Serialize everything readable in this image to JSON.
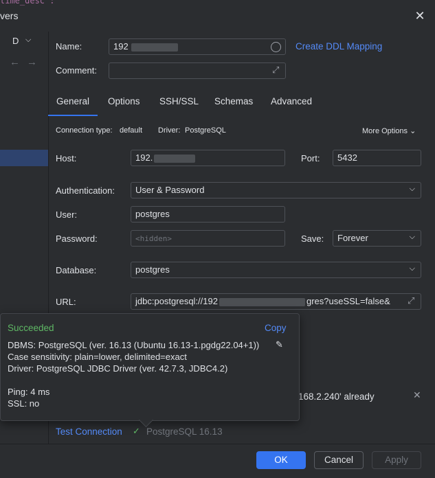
{
  "window": {
    "title": "vers",
    "bg_code": "time_desc :"
  },
  "left": {
    "dropdown_value": "D",
    "back_arrow": "←",
    "forward_arrow": "→"
  },
  "form": {
    "name_label": "Name:",
    "name_value": "192",
    "create_ddl_link": "Create DDL Mapping",
    "comment_label": "Comment:"
  },
  "tabs": [
    "General",
    "Options",
    "SSH/SSL",
    "Schemas",
    "Advanced"
  ],
  "conn_info": {
    "type_label": "Connection type:",
    "type_value": "default",
    "driver_label": "Driver:",
    "driver_value": "PostgreSQL",
    "more_options": "More Options"
  },
  "fields": {
    "host_label": "Host:",
    "host_value": "192.",
    "port_label": "Port:",
    "port_value": "5432",
    "auth_label": "Authentication:",
    "auth_value": "User & Password",
    "user_label": "User:",
    "user_value": "postgres",
    "password_label": "Password:",
    "password_placeholder": "<hidden>",
    "save_label": "Save:",
    "save_value": "Forever",
    "database_label": "Database:",
    "database_value": "postgres",
    "url_label": "URL:",
    "url_prefix": "jdbc:postgresql://192",
    "url_suffix": "gres?useSSL=false&"
  },
  "popup": {
    "status": "Succeeded",
    "copy": "Copy",
    "dbms": "DBMS: PostgreSQL (ver. 16.13 (Ubuntu 16.13-1.pgdg22.04+1))",
    "case": "Case sensitivity: plain=lower, delimited=exact",
    "driver": "Driver: PostgreSQL JDBC Driver (ver. 42.7.3, JDBC4.2)",
    "ping": "Ping: 4 ms",
    "ssl": "SSL: no"
  },
  "notification": {
    "text": "168.2.240' already"
  },
  "footer": {
    "test_connection": "Test Connection",
    "test_result": "PostgreSQL 16.13",
    "ok": "OK",
    "cancel": "Cancel",
    "apply": "Apply"
  },
  "colors": {
    "accent": "#3574f0",
    "link": "#548af7",
    "success": "#5fb865",
    "background": "#2b2d30"
  }
}
